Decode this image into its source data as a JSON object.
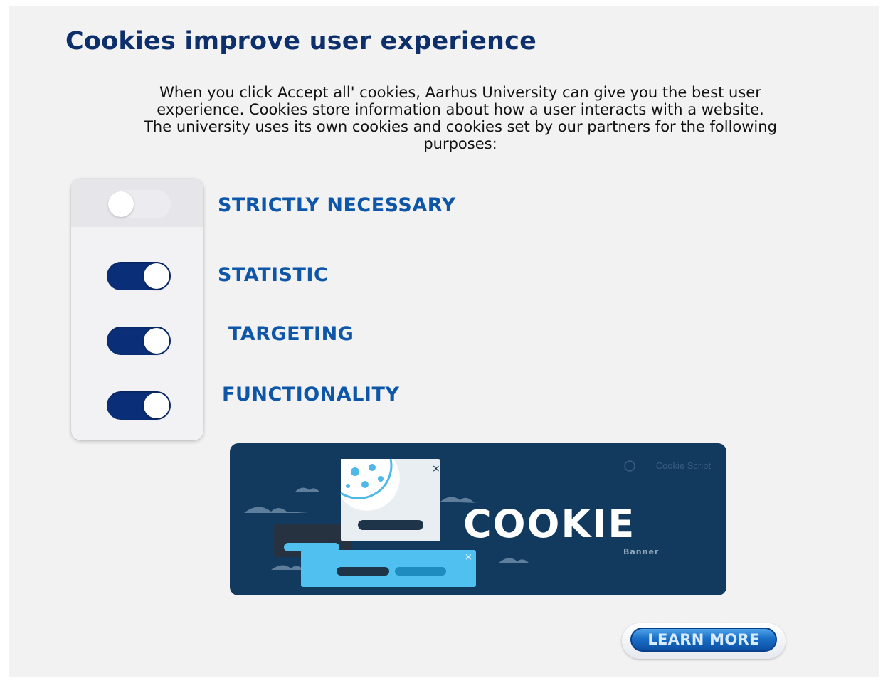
{
  "title": "Cookies improve user experience",
  "intro": {
    "line1": "When you click Accept all' cookies, Aarhus University can give you the best user",
    "line2": "experience. Cookies store information about how a user interacts with a website.",
    "line3": "The university uses its own cookies and cookies set by our partners for the following",
    "line4": "purposes:"
  },
  "categories": [
    {
      "label": "STRICTLY NECESSARY",
      "enabled": false
    },
    {
      "label": "STATISTIC",
      "enabled": true
    },
    {
      "label": "TARGETING",
      "enabled": true
    },
    {
      "label": "FUNCTIONALITY",
      "enabled": true
    }
  ],
  "banner": {
    "brand": "Cookie Script",
    "word": "COOKIE",
    "sub": "Banner"
  },
  "learn_more_label": "LEARN MORE",
  "colors": {
    "title": "#0d2f6b",
    "category_label": "#0d56a8",
    "toggle_on": "#0a2f78",
    "banner_bg": "#123a5e",
    "button": "#1b6fc7"
  }
}
